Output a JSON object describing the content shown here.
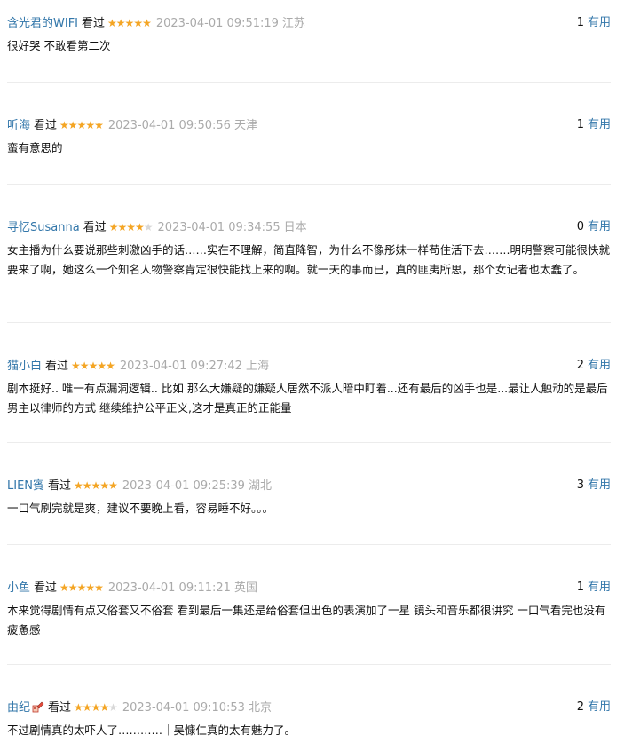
{
  "star_colors": {
    "on": "#f4a524",
    "off": "#d8d8d8"
  },
  "link_color": "#3377aa",
  "comments": [
    {
      "author": "含光君的WIFI",
      "watched": "看过",
      "rating": 5,
      "time": "2023-04-01 09:51:19",
      "location": "江苏",
      "useful_count": "1",
      "useful_label": "有用",
      "content": "很好哭 不敢看第二次"
    },
    {
      "author": "听海",
      "watched": "看过",
      "rating": 5,
      "time": "2023-04-01 09:50:56",
      "location": "天津",
      "useful_count": "1",
      "useful_label": "有用",
      "content": "蛮有意思的"
    },
    {
      "author": "寻忆Susanna",
      "watched": "看过",
      "rating": 4,
      "time": "2023-04-01 09:34:55",
      "location": "日本",
      "useful_count": "0",
      "useful_label": "有用",
      "content": "女主播为什么要说那些刺激凶手的话……实在不理解，简直降智，为什么不像彤妹一样苟住活下去…….明明警察可能很快就要来了啊，她这么一个知名人物警察肯定很快能找上来的啊。就一天的事而已，真的匪夷所思，那个女记者也太蠢了。"
    },
    {
      "author": "猫小白",
      "watched": "看过",
      "rating": 5,
      "time": "2023-04-01 09:27:42",
      "location": "上海",
      "useful_count": "2",
      "useful_label": "有用",
      "content": "剧本挺好.. 唯一有点漏洞逻辑.. 比如 那么大嫌疑的嫌疑人居然不派人暗中盯着...还有最后的凶手也是...最让人触动的是最后男主以律师的方式 继续维护公平正义,这才是真正的正能量"
    },
    {
      "author": "LIEN賓",
      "watched": "看过",
      "rating": 5,
      "time": "2023-04-01 09:25:39",
      "location": "湖北",
      "useful_count": "3",
      "useful_label": "有用",
      "content": "一口气刷完就是爽，建议不要晚上看，容易睡不好。。。"
    },
    {
      "author": "小鱼",
      "watched": "看过",
      "rating": 5,
      "time": "2023-04-01 09:11:21",
      "location": "英国",
      "useful_count": "1",
      "useful_label": "有用",
      "content": "本来觉得剧情有点又俗套又不俗套 看到最后一集还是给俗套但出色的表演加了一星 镜头和音乐都很讲究 一口气看完也没有疲惫感"
    },
    {
      "author": "由纪",
      "badge": "badge-icon",
      "watched": "看过",
      "rating": 4,
      "time": "2023-04-01 09:10:53",
      "location": "北京",
      "useful_count": "2",
      "useful_label": "有用",
      "content": "不过剧情真的太吓人了…………｜吴慷仁真的太有魅力了。"
    }
  ]
}
